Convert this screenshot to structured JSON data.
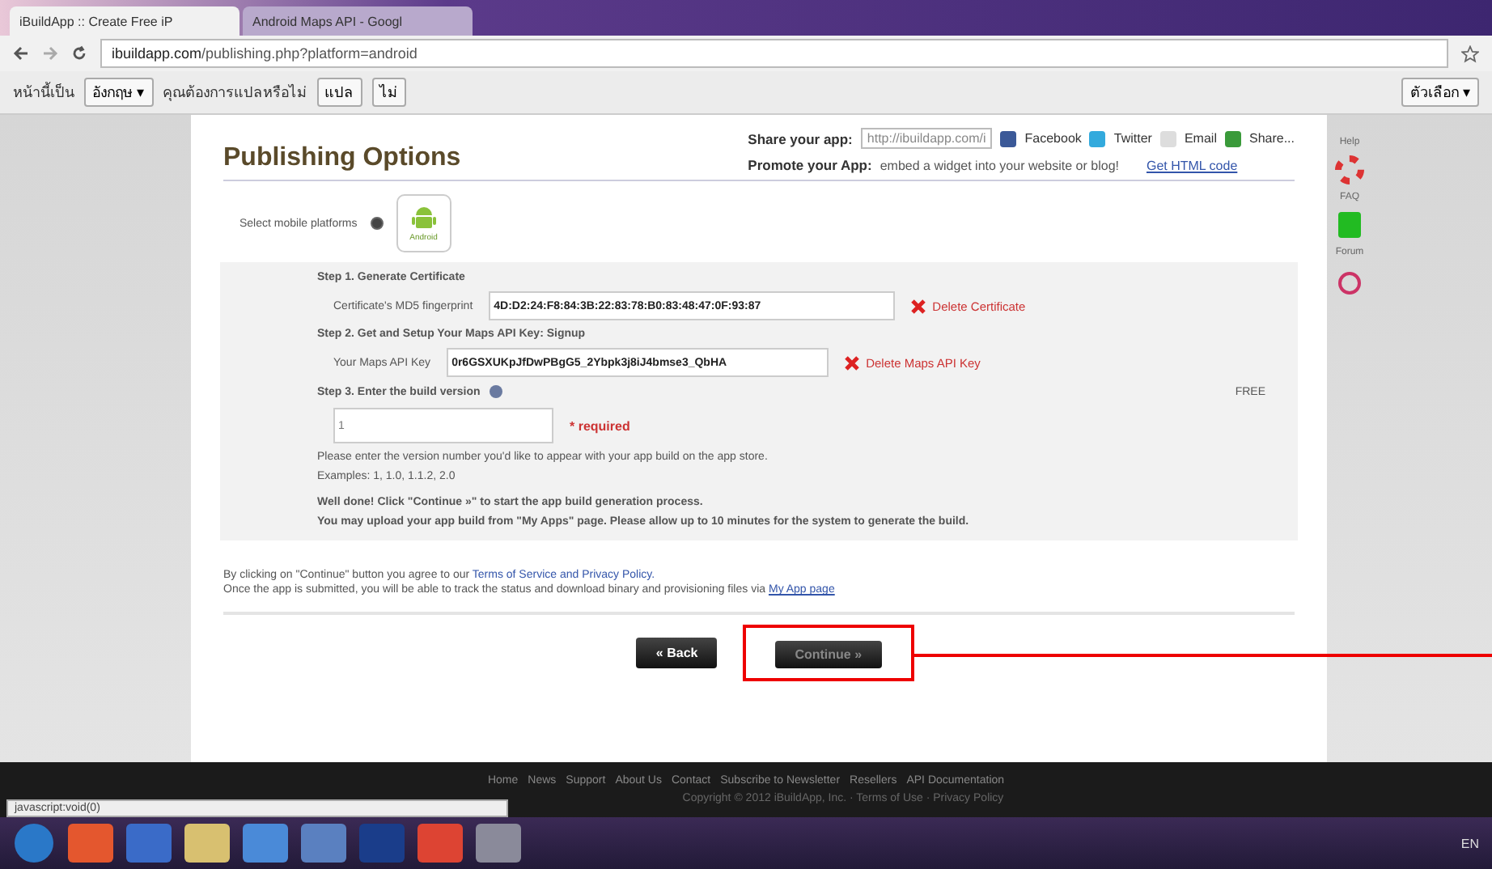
{
  "browser": {
    "tabs": [
      {
        "label": "iBuildApp :: Create Free iP",
        "selected": true
      },
      {
        "label": "Android Maps API - Googl",
        "selected": false
      }
    ],
    "url_host": "ibuildapp.com",
    "url_path": "/publishing.php?platform=android",
    "translate_bar": {
      "message": "หน้านี้เป็น",
      "language": "อังกฤษ ▾",
      "question": "คุณต้องการแปลหรือไม่",
      "translate": "แปล",
      "decline": "ไม่",
      "options": "ตัวเลือก ▾"
    }
  },
  "page": {
    "title": "Publishing Options",
    "share": {
      "label": "Share your app:",
      "url": "http://ibuildapp.com/i",
      "links": [
        "Facebook",
        "Twitter",
        "Email",
        "Share..."
      ]
    },
    "promote": {
      "label": "Promote your App:",
      "text": "embed a widget into your website or blog!",
      "link": "Get HTML code"
    },
    "platforms": {
      "label": "Select mobile platforms",
      "selected": true,
      "name": "Android"
    },
    "steps": [
      {
        "title": "Step 1. Generate Certificate",
        "field_label": "Certificate's MD5 fingerprint",
        "value": "4D:D2:24:F8:84:3B:22:83:78:B0:83:48:47:0F:93:87",
        "action": "Delete Certificate"
      },
      {
        "title": "Step 2. Get and Setup Your Maps API Key: Signup",
        "field_label": "Your Maps API Key",
        "value": "0r6GSXUKpJfDwPBgG5_2Ybpk3j8iJ4bmse3_QbHA",
        "action": "Delete Maps API Key"
      }
    ],
    "step3": {
      "title": "Step 3. Enter the build version",
      "placeholder": "1",
      "required": "* required",
      "price": "FREE",
      "hint": "Please enter the version number you'd like to appear with your app build on the app store.",
      "examples": "Examples: 1, 1.0, 1.1.2, 2.0",
      "done1": "Well done! Click \"Continue »\" to start the app build generation process.",
      "done2": "You may upload your app build from \"My Apps\" page. Please allow up to 10 minutes for the system to generate the build."
    },
    "terms1": "By clicking on \"Continue\" button you agree to our ",
    "terms_link": "Terms of Service and Privacy Policy.",
    "terms2": "Once the app is submitted, you will be able to track the status and download binary and provisioning files via ",
    "terms2_link": "My App page",
    "buttons": [
      {
        "label": "« Back",
        "disabled": false,
        "highlighted": false
      },
      {
        "label": "Continue »",
        "disabled": true,
        "highlighted": true
      }
    ],
    "side": [
      "Help",
      "FAQ",
      "Forum"
    ]
  },
  "footer": {
    "links": [
      "Home",
      "News",
      "Support",
      "About Us",
      "Contact",
      "Subscribe to Newsletter",
      "Resellers",
      "API Documentation"
    ],
    "copyright": "Copyright © 2012 iBuildApp, Inc. · Terms of Use · Privacy Policy"
  },
  "status_text": "javascript:void(0)",
  "taskbar": {
    "language": "EN"
  }
}
